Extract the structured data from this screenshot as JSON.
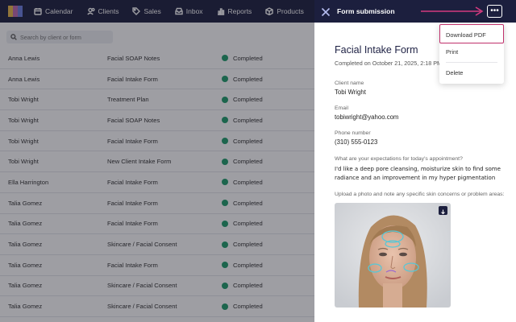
{
  "nav": {
    "items": [
      {
        "label": "Calendar",
        "icon": "calendar-icon"
      },
      {
        "label": "Clients",
        "icon": "clients-icon"
      },
      {
        "label": "Sales",
        "icon": "tag-icon"
      },
      {
        "label": "Inbox",
        "icon": "inbox-icon"
      },
      {
        "label": "Reports",
        "icon": "bar-chart-icon"
      },
      {
        "label": "Products",
        "icon": "box-icon"
      }
    ]
  },
  "search": {
    "placeholder": "Search by client or form"
  },
  "rows": [
    {
      "client": "Anna Lewis",
      "form": "Facial SOAP Notes",
      "status": "Completed"
    },
    {
      "client": "Anna Lewis",
      "form": "Facial Intake Form",
      "status": "Completed"
    },
    {
      "client": "Tobi Wright",
      "form": "Treatment Plan",
      "status": "Completed"
    },
    {
      "client": "Tobi Wright",
      "form": "Facial SOAP Notes",
      "status": "Completed"
    },
    {
      "client": "Tobi Wright",
      "form": "Facial Intake Form",
      "status": "Completed"
    },
    {
      "client": "Tobi Wright",
      "form": "New Client Intake Form",
      "status": "Completed"
    },
    {
      "client": "Ella Harrington",
      "form": "Facial Intake Form",
      "status": "Completed"
    },
    {
      "client": "Talia Gomez",
      "form": "Facial Intake Form",
      "status": "Completed"
    },
    {
      "client": "Talia Gomez",
      "form": "Facial Intake Form",
      "status": "Completed"
    },
    {
      "client": "Talia Gomez",
      "form": "Skincare / Facial Consent",
      "status": "Completed"
    },
    {
      "client": "Talia Gomez",
      "form": "Facial Intake Form",
      "status": "Completed"
    },
    {
      "client": "Talia Gomez",
      "form": "Skincare / Facial Consent",
      "status": "Completed"
    },
    {
      "client": "Talia Gomez",
      "form": "Skincare / Facial Consent",
      "status": "Completed"
    }
  ],
  "panel": {
    "title": "Form submission",
    "more_label": "•••",
    "form_title": "Facial Intake Form",
    "completed": "Completed on October 21, 2025, 2:18 PM",
    "fields": {
      "client_name_label": "Client name",
      "client_name": "Tobi Wright",
      "email_label": "Email",
      "email": "tobiwright@yahoo.com",
      "phone_label": "Phone number",
      "phone": "(310) 555-0123",
      "expect_q": "What are your expectations for today's appointment?",
      "expect_a": "I'd like a deep pore cleansing, moisturize skin to find some radiance and an improvement in my hyper pigmentation",
      "photo_q": "Upload a photo and note any specific skin concerns or problem areas:"
    }
  },
  "menu": {
    "items": [
      "Download PDF",
      "Print",
      "Delete"
    ]
  },
  "colors": {
    "nav_bg": "#1c1f3e",
    "status_green": "#1f9d6b",
    "highlight": "#c0306b"
  }
}
